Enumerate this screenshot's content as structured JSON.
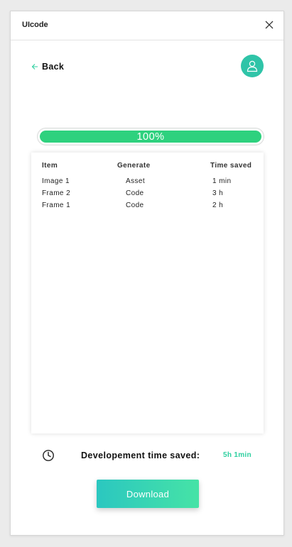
{
  "app": {
    "title": "UIcode"
  },
  "titlebar": {
    "close_icon": "close-icon"
  },
  "nav": {
    "back_label": "Back",
    "back_icon": "arrow-left-icon"
  },
  "user": {
    "avatar_icon": "user-icon",
    "avatar_color": "#2fc4a8"
  },
  "progress": {
    "value": 100,
    "label": "100%",
    "color": "#2ed17e"
  },
  "table": {
    "headers": {
      "item": "Item",
      "generate": "Generate",
      "time": "Time saved"
    },
    "rows": [
      {
        "item": "Image 1",
        "generate": "Asset",
        "time": "1 min"
      },
      {
        "item": "Frame 2",
        "generate": "Code",
        "time": "3 h"
      },
      {
        "item": "Frame 1",
        "generate": "Code",
        "time": "2 h"
      }
    ]
  },
  "summary": {
    "icon": "clock-icon",
    "label": "Developement time saved:",
    "value": "5h 1min",
    "value_color": "#2fd0a0"
  },
  "download": {
    "label": "Download"
  }
}
